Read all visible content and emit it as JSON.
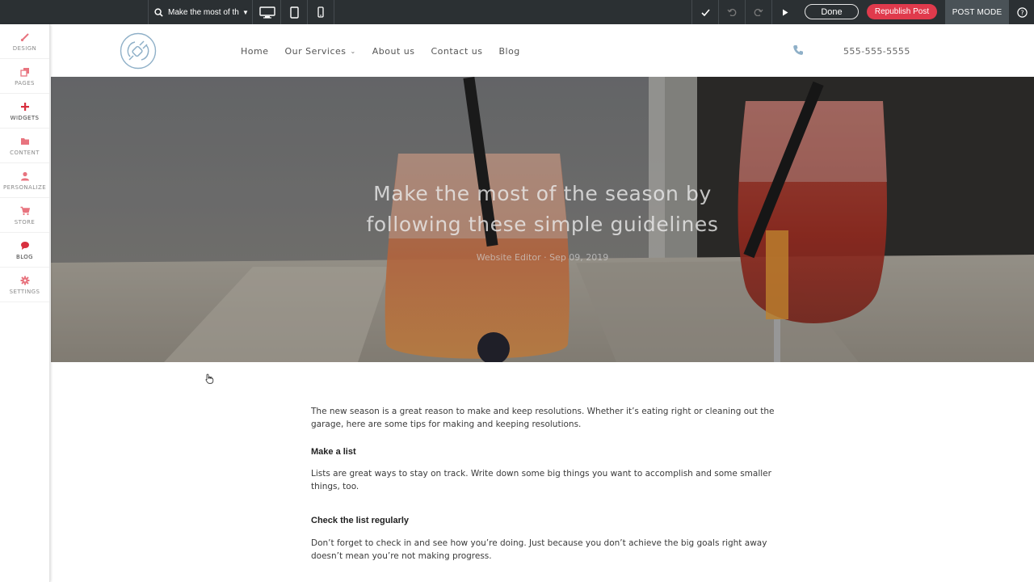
{
  "editor_bar": {
    "page_selector": {
      "label": "Make the most of th..."
    },
    "done_label": "Done",
    "republish_label": "Republish Post",
    "mode_label": "POST MODE"
  },
  "sidebar": {
    "items": [
      {
        "label": "DESIGN",
        "icon": "brush-icon"
      },
      {
        "label": "PAGES",
        "icon": "pages-icon"
      },
      {
        "label": "WIDGETS",
        "icon": "plus-icon"
      },
      {
        "label": "CONTENT",
        "icon": "folder-icon"
      },
      {
        "label": "PERSONALIZE",
        "icon": "person-icon"
      },
      {
        "label": "STORE",
        "icon": "cart-icon"
      },
      {
        "label": "BLOG",
        "icon": "speech-bubble-icon"
      },
      {
        "label": "SETTINGS",
        "icon": "gear-icon"
      }
    ]
  },
  "site_header": {
    "nav": [
      {
        "label": "Home"
      },
      {
        "label": "Our Services"
      },
      {
        "label": "About us"
      },
      {
        "label": "Contact us"
      },
      {
        "label": "Blog"
      }
    ],
    "phone": "555-555-5555"
  },
  "hero": {
    "title_line1": "Make the most of the season by",
    "title_line2": "following these simple guidelines",
    "meta": "Website Editor · Sep 09, 2019"
  },
  "article": {
    "intro": "The new season is a great reason to make and keep resolutions. Whether it’s eating right or cleaning out the garage, here are some tips for making and keeping resolutions.",
    "heading1": "Make a list",
    "para1": "Lists are great ways to stay on track. Write down some big things you want to accomplish and some smaller things, too.",
    "heading2": "Check the list regularly",
    "para2": "Don’t forget to check in and see how you’re doing. Just because you don’t achieve the big goals right away doesn’t mean you’re not making progress."
  },
  "colors": {
    "accent": "#e03a4c",
    "topbar": "#2b3033",
    "sidebar_icon": "#e8747f"
  }
}
